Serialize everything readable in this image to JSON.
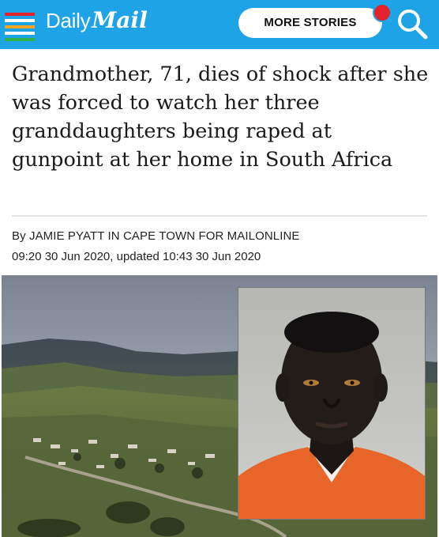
{
  "header": {
    "brand_part1": "Daily",
    "brand_part2": "Mail",
    "more_stories_label": "MORE STORIES",
    "colors": {
      "bar": "#1ea4e6",
      "menu_stripes": [
        "#e3222b",
        "#f5a623",
        "#2db34a"
      ],
      "notification": "#e3222b"
    },
    "icons": {
      "menu": "hamburger-menu-icon",
      "search": "search-icon"
    }
  },
  "article": {
    "headline": "Grandmother, 71, dies of shock after she was forced to watch her three granddaughters being raped at gunpoint at her home in South Africa",
    "byline": "By JAMIE PYATT IN CAPE TOWN FOR MAILONLINE",
    "dateline": "09:20 30 Jun 2020, updated 10:43 30 Jun 2020"
  }
}
